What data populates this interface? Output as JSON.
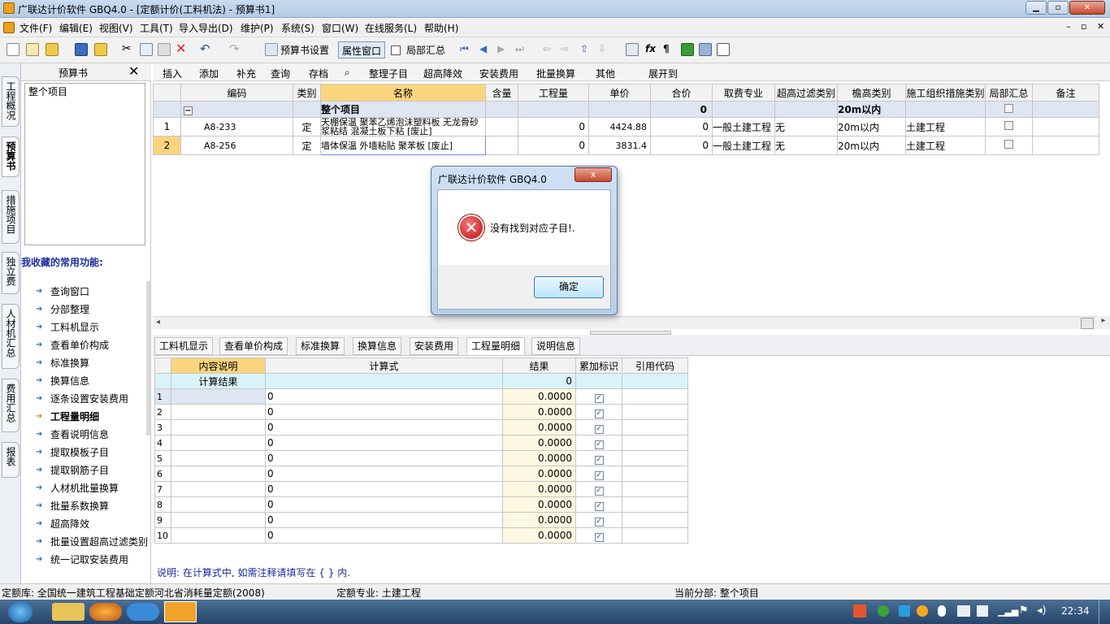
{
  "window": {
    "title": "广联达计价软件 GBQ4.0 - [定额计价(工料机法) - 预算书1]"
  },
  "menus": [
    "文件(F)",
    "编辑(E)",
    "视图(V)",
    "工具(T)",
    "导入导出(D)",
    "维护(P)",
    "系统(S)",
    "窗口(W)",
    "在线服务(L)",
    "帮助(H)"
  ],
  "toolbar": {
    "budget_settings": "预算书设置",
    "property_window": "属性窗口",
    "local_summary": "局部汇总"
  },
  "left_tabs": [
    "工程概况",
    "预算书",
    "措施项目",
    "独立费",
    "人材机汇总",
    "费用汇总",
    "报表"
  ],
  "left_panel": {
    "title": "预算书",
    "tree_item": "整个项目",
    "fav_title": "我收藏的常用功能:",
    "fav_items": [
      "查询窗口",
      "分部整理",
      "工料机显示",
      "查看单价构成",
      "标准换算",
      "换算信息",
      "逐条设置安装费用",
      "工程量明细",
      "查看说明信息",
      "提取模板子目",
      "提取钢筋子目",
      "人材机批量换算",
      "批量系数换算",
      "超高降效",
      "批量设置超高过滤类别",
      "统一记取安装费用"
    ]
  },
  "table_toolbar": [
    "插入",
    "添加",
    "补充",
    "查询",
    "存档",
    "整理子目",
    "超高降效",
    "安装费用",
    "批量换算",
    "其他",
    "展开到"
  ],
  "main_grid": {
    "headers": [
      "编码",
      "类别",
      "名称",
      "含量",
      "工程量",
      "单价",
      "合价",
      "取费专业",
      "超高过滤类别",
      "檐高类别",
      "施工组织措施类别",
      "局部汇总",
      "备注"
    ],
    "group": {
      "toggle": "−",
      "name": "整个项目",
      "total": "0",
      "eaves": "20m以内"
    },
    "rows": [
      {
        "no": "1",
        "code": "A8-233",
        "type": "定",
        "name": "天棚保温 聚苯乙烯泡沫塑料板 无龙骨砂浆粘结 混凝土板下粘 [废止]",
        "qty": "0",
        "price": "4424.88",
        "total": "0",
        "major": "一般土建工程",
        "filter": "无",
        "eaves": "20m以内",
        "measure": "土建工程"
      },
      {
        "no": "2",
        "code": "A8-256",
        "type": "定",
        "name": "墙体保温 外墙粘贴 聚苯板 [废止]",
        "qty": "0",
        "price": "3831.4",
        "total": "0",
        "major": "一般土建工程",
        "filter": "无",
        "eaves": "20m以内",
        "measure": "土建工程"
      }
    ]
  },
  "bottom_tabs": [
    "工料机显示",
    "查看单价构成",
    "标准换算",
    "换算信息",
    "安装费用",
    "工程量明细",
    "说明信息"
  ],
  "detail_grid": {
    "headers": [
      "内容说明",
      "计算式",
      "结果",
      "累加标识",
      "引用代码"
    ],
    "calc_label": "计算结果",
    "calc_value": "0",
    "rows": [
      {
        "no": "1",
        "formula": "0",
        "result": "0.0000"
      },
      {
        "no": "2",
        "formula": "0",
        "result": "0.0000"
      },
      {
        "no": "3",
        "formula": "0",
        "result": "0.0000"
      },
      {
        "no": "4",
        "formula": "0",
        "result": "0.0000"
      },
      {
        "no": "5",
        "formula": "0",
        "result": "0.0000"
      },
      {
        "no": "6",
        "formula": "0",
        "result": "0.0000"
      },
      {
        "no": "7",
        "formula": "0",
        "result": "0.0000"
      },
      {
        "no": "8",
        "formula": "0",
        "result": "0.0000"
      },
      {
        "no": "9",
        "formula": "0",
        "result": "0.0000"
      },
      {
        "no": "10",
        "formula": "0",
        "result": "0.0000"
      }
    ]
  },
  "hint": "说明: 在计算式中, 如需注释请填写在 { } 内.",
  "status": {
    "quota_lib": "定额库: 全国统一建筑工程基础定额河北省消耗量定额(2008)",
    "major": "定额专业: 土建工程",
    "current": "当前分部: 整个项目"
  },
  "dialog": {
    "title": "广联达计价软件 GBQ4.0",
    "message": "没有找到对应子目!.",
    "ok": "确定",
    "close": "x"
  },
  "taskbar": {
    "time": "22:34"
  }
}
